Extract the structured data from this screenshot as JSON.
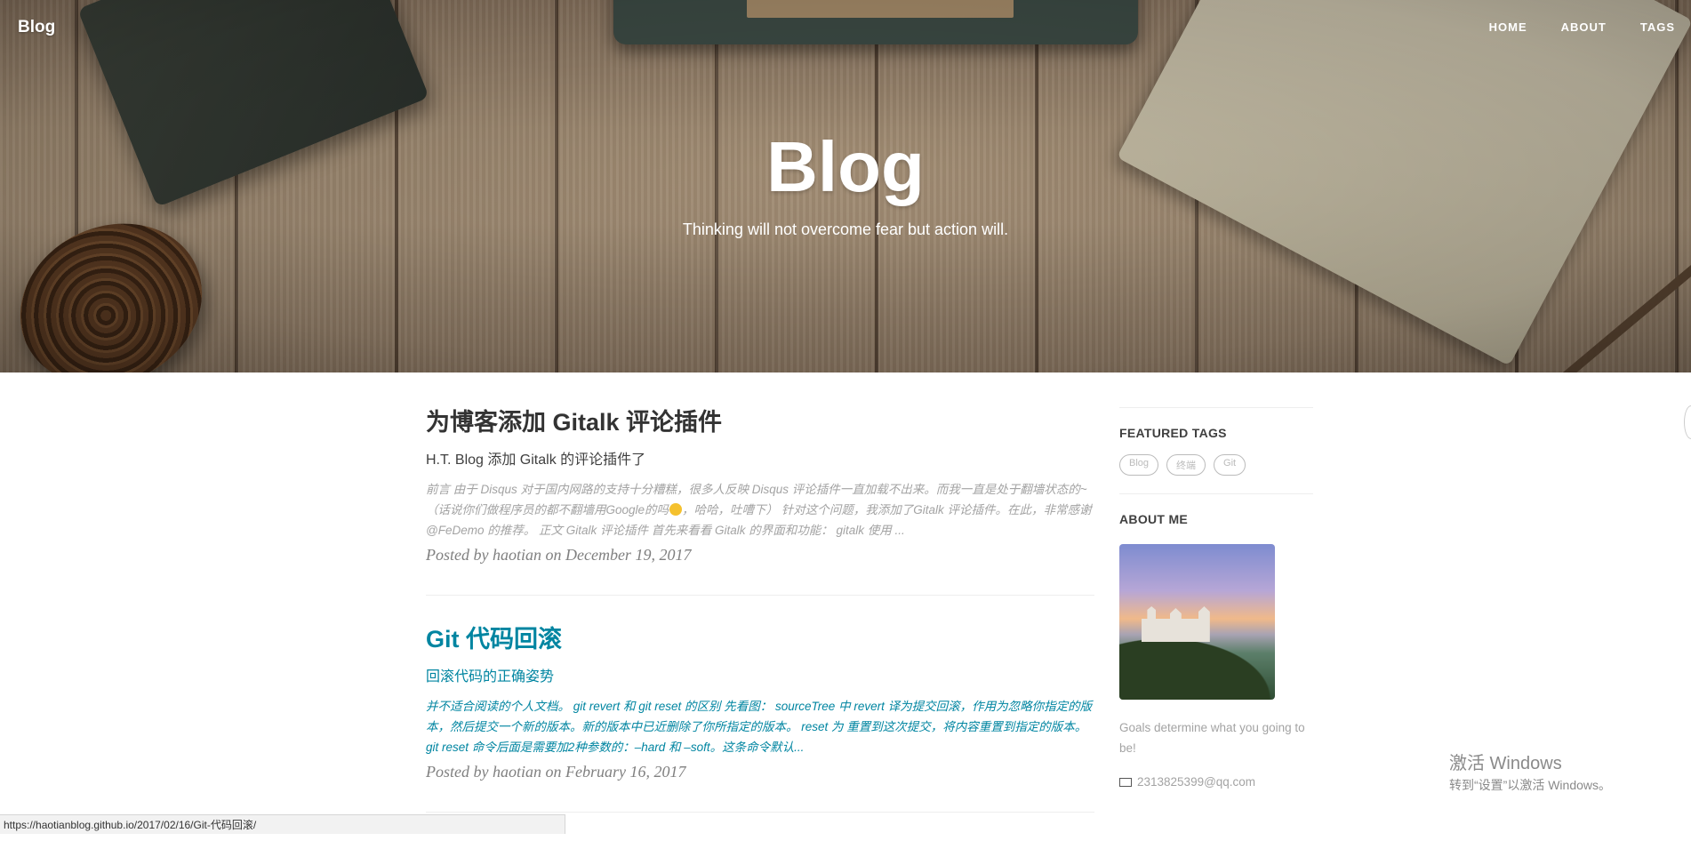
{
  "nav": {
    "brand": "Blog",
    "links": [
      "HOME",
      "ABOUT",
      "TAGS"
    ]
  },
  "hero": {
    "title": "Blog",
    "subtitle": "Thinking will not overcome fear but action will."
  },
  "posts": [
    {
      "title": "为博客添加 Gitalk 评论插件",
      "subtitle": "H.T. Blog 添加 Gitalk 的评论插件了",
      "excerpt_a": "前言 由于 Disqus 对于国内网路的支持十分糟糕，很多人反映 Disqus 评论插件一直加载不出来。而我一直是处于翻墙状态的~（话说你们做程序员的都不翻墙用Google的吗",
      "excerpt_b": "，哈哈，吐嘈下） 针对这个问题，我添加了Gitalk 评论插件。在此，非常感谢 @FeDemo 的推荐。 正文 Gitalk 评论插件 首先来看看 Gitalk 的界面和功能： gitalk 使用 ...",
      "meta": "Posted by haotian on December 19, 2017",
      "hovered": false
    },
    {
      "title": "Git 代码回滚",
      "subtitle": "回滚代码的正确姿势",
      "excerpt_a": "并不适合阅读的个人文档。 git revert 和 git reset 的区别 先看图： sourceTree 中 revert 译为提交回滚，作用为忽略你指定的版本，然后提交一个新的版本。新的版本中已近删除了你所指定的版本。 reset 为 重置到这次提交，将内容重置到指定的版本。git reset 命令后面是需要加2种参数的：–hard 和 –soft。这条命令默认...",
      "excerpt_b": "",
      "meta": "Posted by haotian on February 16, 2017",
      "hovered": true
    }
  ],
  "sidebar": {
    "featured_tags_heading": "FEATURED TAGS",
    "tags": [
      "Blog",
      "终端",
      "Git"
    ],
    "about_heading": "ABOUT ME",
    "about_text": "Goals determine what you going to be!",
    "email": "2313825399@qq.com"
  },
  "status_bar": {
    "url": "https://haotianblog.github.io/2017/02/16/Git-代码回滚/"
  },
  "watermark": {
    "line1": "激活 Windows",
    "line2": "转到“设置”以激活 Windows。"
  },
  "colors": {
    "link_hover": "#0085a1",
    "muted_text": "#a3a3a3"
  }
}
